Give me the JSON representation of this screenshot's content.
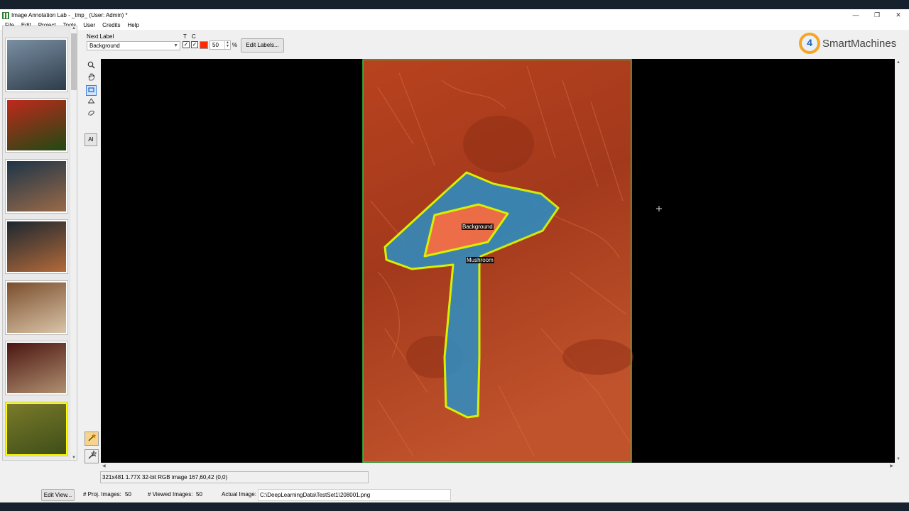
{
  "window": {
    "title": "Image Annotation Lab - _tmp_  (User: Admin) *",
    "controls": [
      "—",
      "❐",
      "✕"
    ]
  },
  "menu": [
    "File",
    "Edit",
    "Project",
    "Tools",
    "User",
    "Credits",
    "Help"
  ],
  "toolbar": {
    "next_label_title": "Next Label",
    "next_label_value": "Background",
    "t_label": "T",
    "c_label": "C",
    "color": "#ff2a00",
    "opacity_value": "50",
    "percent": "%",
    "edit_labels_button": "Edit Labels..."
  },
  "logo": {
    "digit": "4",
    "text": "SmartMachines"
  },
  "tools": {
    "zoom_icon": "magnifier-icon",
    "pan_icon": "hand-icon",
    "rect_icon": "rectangle-icon",
    "polygon_icon": "polygon-icon",
    "freehand_icon": "lasso-icon",
    "ai_label": "AI",
    "magic1_icon": "magic-wand-icon",
    "magic2_icon": "magic-wand-outline-icon"
  },
  "thumbnails": [
    {
      "name": "thumb-rocket",
      "colors": [
        "#7a8fa3",
        "#2e3c4a"
      ]
    },
    {
      "name": "thumb-flowers",
      "colors": [
        "#c0281c",
        "#1f4a13"
      ]
    },
    {
      "name": "thumb-swimmer",
      "colors": [
        "#1d3448",
        "#9a6a48"
      ]
    },
    {
      "name": "thumb-swim-race",
      "colors": [
        "#1c2730",
        "#b36a3a"
      ]
    },
    {
      "name": "thumb-woman",
      "colors": [
        "#7a4e2c",
        "#d9c4a8"
      ]
    },
    {
      "name": "thumb-man-fez",
      "colors": [
        "#4a1510",
        "#b09070"
      ]
    },
    {
      "name": "thumb-mushroom",
      "colors": [
        "#7a7a2a",
        "#3e4e18"
      ],
      "selected": true
    }
  ],
  "annotations": [
    {
      "label": "Background",
      "color": "#ff6a3d"
    },
    {
      "label": "Mushroom",
      "color": "#1aa3e0"
    }
  ],
  "status": {
    "image_info": "321x481 1.77X 32-bit RGB image 167,60,42  (0,0)"
  },
  "bottom": {
    "edit_view_button": "Edit View...",
    "proj_images_label": "# Proj. Images:",
    "proj_images_value": "50",
    "viewed_images_label": "# Viewed Images:",
    "viewed_images_value": "50",
    "actual_image_label": "Actual Image:",
    "actual_image_path": "C:\\DeepLearningData\\TestSet1\\208001.png"
  }
}
